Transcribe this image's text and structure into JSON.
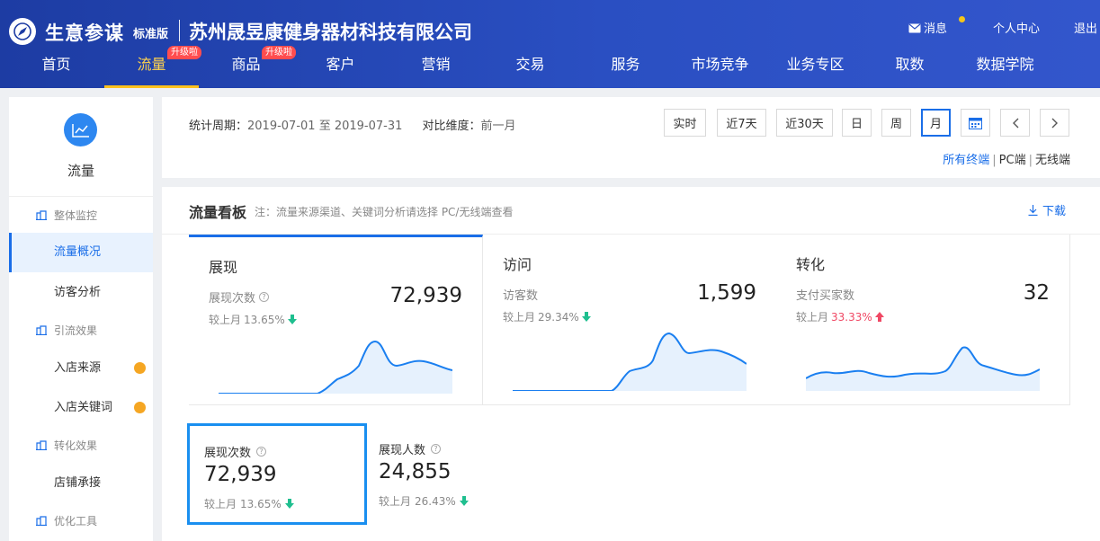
{
  "header": {
    "brand": "生意参谋",
    "edition": "标准版",
    "company": "苏州晟昱康健身器材科技有限公司",
    "links": {
      "message": "消息",
      "personal": "个人中心",
      "logout": "退出"
    },
    "nav": [
      {
        "label": "首页",
        "badge": ""
      },
      {
        "label": "流量",
        "badge": "升级啦",
        "active": true
      },
      {
        "label": "商品",
        "badge": "升级啦"
      },
      {
        "label": "客户",
        "badge": ""
      },
      {
        "label": "营销",
        "badge": ""
      },
      {
        "label": "交易",
        "badge": ""
      },
      {
        "label": "服务",
        "badge": ""
      },
      {
        "label": "市场竞争",
        "badge": ""
      },
      {
        "label": "业务专区",
        "badge": ""
      },
      {
        "label": "取数",
        "badge": ""
      },
      {
        "label": "数据学院",
        "badge": ""
      }
    ]
  },
  "sidebar": {
    "title": "流量",
    "groups": {
      "overall": "整体监控",
      "traffic_source": "引流效果",
      "conversion": "转化效果",
      "optimize": "优化工具"
    },
    "items": {
      "overview": "流量概况",
      "visitor_analysis": "访客分析",
      "store_source": "入店来源",
      "store_keyword": "入店关键词",
      "store_landing": "店铺承接"
    }
  },
  "filter": {
    "period_label": "统计周期：",
    "period_value": "2019-07-01 至 2019-07-31",
    "compare_label": "对比维度：",
    "compare_value": "前一月",
    "buttons": {
      "realtime": "实时",
      "d7": "近7天",
      "d30": "近30天",
      "day": "日",
      "week": "周",
      "month": "月"
    },
    "terminals": {
      "all": "所有终端",
      "pc": "PC端",
      "wireless": "无线端"
    }
  },
  "dashboard": {
    "title": "流量看板",
    "note": "注：流量来源渠道、关键词分析请选择 PC/无线端查看",
    "download": "下载",
    "cards": [
      {
        "title": "展现",
        "label": "展现次数",
        "value": "72,939",
        "cmp_prefix": "较上月",
        "cmp_value": "13.65%",
        "trend": "down"
      },
      {
        "title": "访问",
        "label": "访客数",
        "value": "1,599",
        "cmp_prefix": "较上月",
        "cmp_value": "29.34%",
        "trend": "down"
      },
      {
        "title": "转化",
        "label": "支付买家数",
        "value": "32",
        "cmp_prefix": "较上月",
        "cmp_value": "33.33%",
        "trend": "up"
      }
    ],
    "metrics": [
      {
        "label": "展现次数",
        "value": "72,939",
        "cmp_prefix": "较上月",
        "cmp_value": "13.65%",
        "trend": "down"
      },
      {
        "label": "展现人数",
        "value": "24,855",
        "cmp_prefix": "较上月",
        "cmp_value": "26.43%",
        "trend": "down"
      }
    ]
  },
  "colors": {
    "nav_bg": "#2a4fc2",
    "accent": "#1a6ee8",
    "active_nav": "#ffc11c",
    "badge": "#ff4d4f",
    "down": "#1fbf8f",
    "up": "#f04864"
  }
}
